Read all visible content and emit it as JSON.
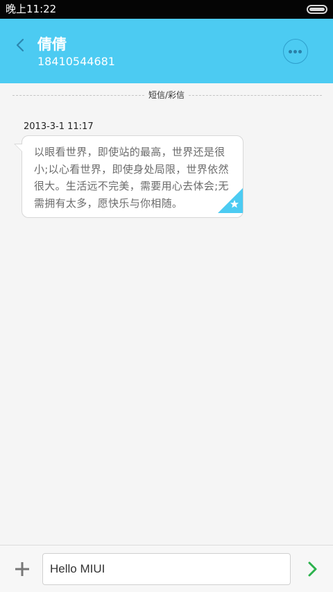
{
  "status_bar": {
    "time": "晚上11:22",
    "battery_level": 1.0
  },
  "header": {
    "contact_name": "倩倩",
    "contact_number": "18410544681",
    "back_icon": "chevron-left-icon",
    "more_icon": "more-horizontal-icon"
  },
  "conversation": {
    "type_label": "短信/彩信",
    "messages": [
      {
        "time": "2013-3-1 11:17",
        "text": "以眼看世界，即使站的最高，世界还是很小;以心看世界，即使身处局限，世界依然很大。生活远不完美，需要用心去体会;无需拥有太多，愿快乐与你相随。",
        "starred": true
      }
    ]
  },
  "composer": {
    "input_value": "Hello MIUI",
    "add_icon": "plus-icon",
    "send_icon": "chevron-right-icon"
  },
  "colors": {
    "header": "#4ccbf2",
    "star_corner": "#4ccbf2",
    "send": "#2bb24c"
  }
}
